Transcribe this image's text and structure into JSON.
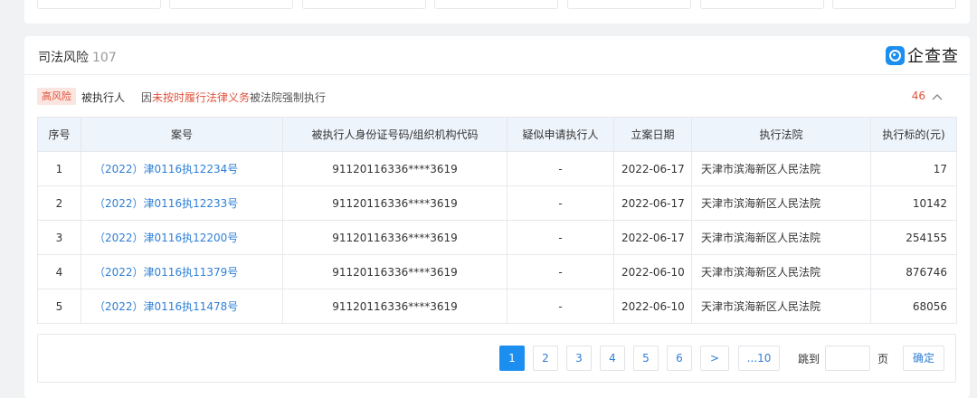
{
  "section": {
    "title": "司法风险",
    "count": "107"
  },
  "logo": {
    "text": "企查查"
  },
  "risk": {
    "badge": "高风险",
    "type": "被执行人",
    "desc_prefix": "因",
    "desc_highlight": "未按时履行法律义务",
    "desc_suffix": "被法院强制执行",
    "count": "46"
  },
  "table": {
    "headers": [
      "序号",
      "案号",
      "被执行人身份证号码/组织机构代码",
      "疑似申请执行人",
      "立案日期",
      "执行法院",
      "执行标的(元)"
    ],
    "rows": [
      {
        "no": "1",
        "case": "（2022）津0116执12234号",
        "id": "91120116336****3619",
        "applicant": "-",
        "date": "2022-06-17",
        "court": "天津市滨海新区人民法院",
        "amount": "17"
      },
      {
        "no": "2",
        "case": "（2022）津0116执12233号",
        "id": "91120116336****3619",
        "applicant": "-",
        "date": "2022-06-17",
        "court": "天津市滨海新区人民法院",
        "amount": "10142"
      },
      {
        "no": "3",
        "case": "（2022）津0116执12200号",
        "id": "91120116336****3619",
        "applicant": "-",
        "date": "2022-06-17",
        "court": "天津市滨海新区人民法院",
        "amount": "254155"
      },
      {
        "no": "4",
        "case": "（2022）津0116执11379号",
        "id": "91120116336****3619",
        "applicant": "-",
        "date": "2022-06-10",
        "court": "天津市滨海新区人民法院",
        "amount": "876746"
      },
      {
        "no": "5",
        "case": "（2022）津0116执11478号",
        "id": "91120116336****3619",
        "applicant": "-",
        "date": "2022-06-10",
        "court": "天津市滨海新区人民法院",
        "amount": "68056"
      }
    ]
  },
  "pagination": {
    "pages": [
      "1",
      "2",
      "3",
      "4",
      "5",
      "6"
    ],
    "next": ">",
    "last": "...10",
    "jump_label": "跳到",
    "page_label": "页",
    "confirm": "确定",
    "current": "1"
  },
  "colors": {
    "accent": "#1b8ef0",
    "link": "#2f7fd6",
    "risk": "#e0533d",
    "header_bg": "#eef4fb"
  }
}
